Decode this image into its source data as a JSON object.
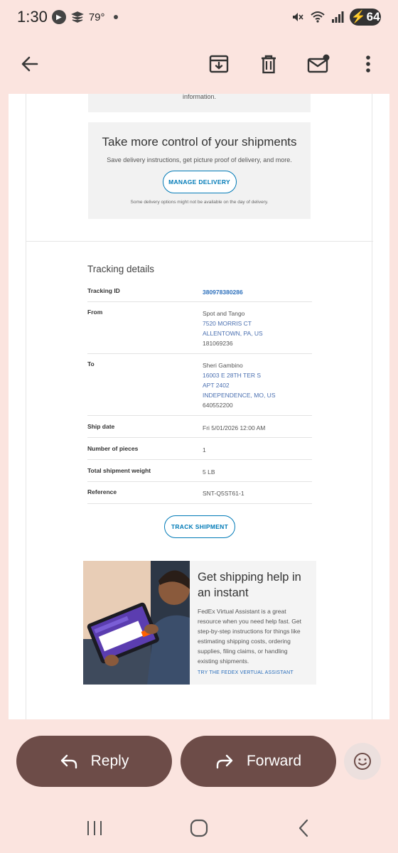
{
  "status": {
    "time": "1:30",
    "temperature": "79°",
    "battery": "64"
  },
  "email": {
    "top_fragment": "information.",
    "promo": {
      "title": "Take more control of your shipments",
      "subtitle": "Save delivery instructions, get picture proof of delivery, and more.",
      "button": "MANAGE DELIVERY",
      "note": "Some delivery options might not be available on the day of delivery."
    },
    "tracking": {
      "title": "Tracking details",
      "rows": {
        "id": {
          "label": "Tracking ID",
          "value": "380978380286"
        },
        "from": {
          "label": "From",
          "name": "Spot and Tango",
          "address1": "7520 MORRIS CT",
          "city": "ALLENTOWN, PA, US",
          "phone": "181069236"
        },
        "to": {
          "label": "To",
          "name": "Sheri Gambino",
          "address1": "16003 E 28TH TER S",
          "address2": "APT 2402",
          "city": "INDEPENDENCE, MO, US",
          "phone": "640552200"
        },
        "ship_date": {
          "label": "Ship date",
          "value": "Fri 5/01/2026 12:00 AM"
        },
        "pieces": {
          "label": "Number of pieces",
          "value": "1"
        },
        "weight": {
          "label": "Total shipment weight",
          "value": "5 LB"
        },
        "reference": {
          "label": "Reference",
          "value": "SNT-Q5ST61-1"
        }
      },
      "button": "TRACK SHIPMENT"
    },
    "help": {
      "title": "Get shipping help in an instant",
      "body": "FedEx Virtual Assistant is a great resource when you need help fast. Get step-by-step instructions for things like estimating shipping costs, ordering supplies, filing claims, or handling existing shipments.",
      "link": "TRY THE FEDEX VERTUAL ASSISTANT"
    }
  },
  "actions": {
    "reply": "Reply",
    "forward": "Forward"
  },
  "icons": {
    "back": "arrow-left-icon",
    "archive": "archive-icon",
    "delete": "trash-icon",
    "mark_unread": "mail-unread-icon",
    "more": "more-vert-icon",
    "emoji": "emoji-icon"
  },
  "colors": {
    "background": "#fbe4df",
    "action_button": "#6d4c48",
    "link_blue": "#007ab7"
  }
}
